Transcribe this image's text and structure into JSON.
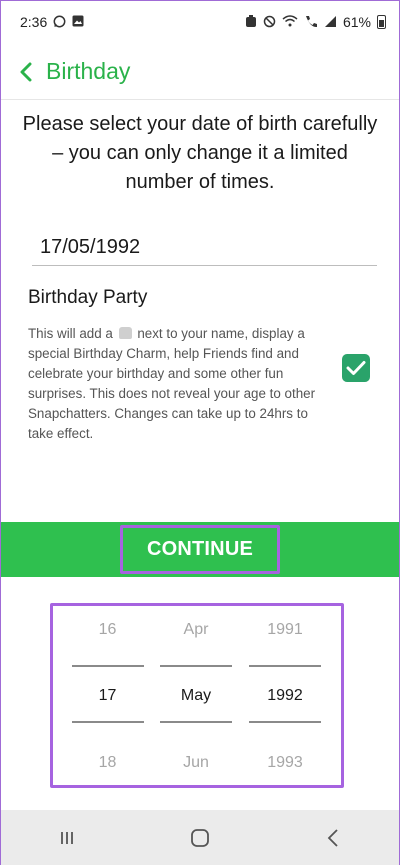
{
  "status_bar": {
    "time": "2:36",
    "battery": "61%",
    "left_icons": [
      "whatsapp-icon",
      "gallery-icon"
    ],
    "right_icons": [
      "alarm-icon",
      "mute-icon",
      "wifi-icon",
      "call-icon",
      "signal-icon",
      "battery-icon"
    ]
  },
  "header": {
    "title": "Birthday",
    "back_icon": "chevron-left-icon"
  },
  "intro_text": "Please select your date of birth carefully – you can only change it a limited number of times.",
  "date_field": {
    "value": "17/05/1992"
  },
  "birthday_party": {
    "title": "Birthday Party",
    "description_before_icon": "This will add a",
    "description_after_icon": "next to your name, display a special Birthday Charm, help Friends find and celebrate your birthday and some other fun surprises. This does not reveal your age to other Snapchatters. Changes can take up to 24hrs to take effect.",
    "checked": true
  },
  "continue_button": {
    "label": "CONTINUE"
  },
  "picker": {
    "day": {
      "prev": "16",
      "selected": "17",
      "next": "18"
    },
    "month": {
      "prev": "Apr",
      "selected": "May",
      "next": "Jun"
    },
    "year": {
      "prev": "1991",
      "selected": "1992",
      "next": "1993"
    }
  },
  "colors": {
    "brand_green": "#2fc04f",
    "title_green": "#2ab24a",
    "checkbox_green": "#2aa36a",
    "highlight_purple": "#a663e0"
  }
}
